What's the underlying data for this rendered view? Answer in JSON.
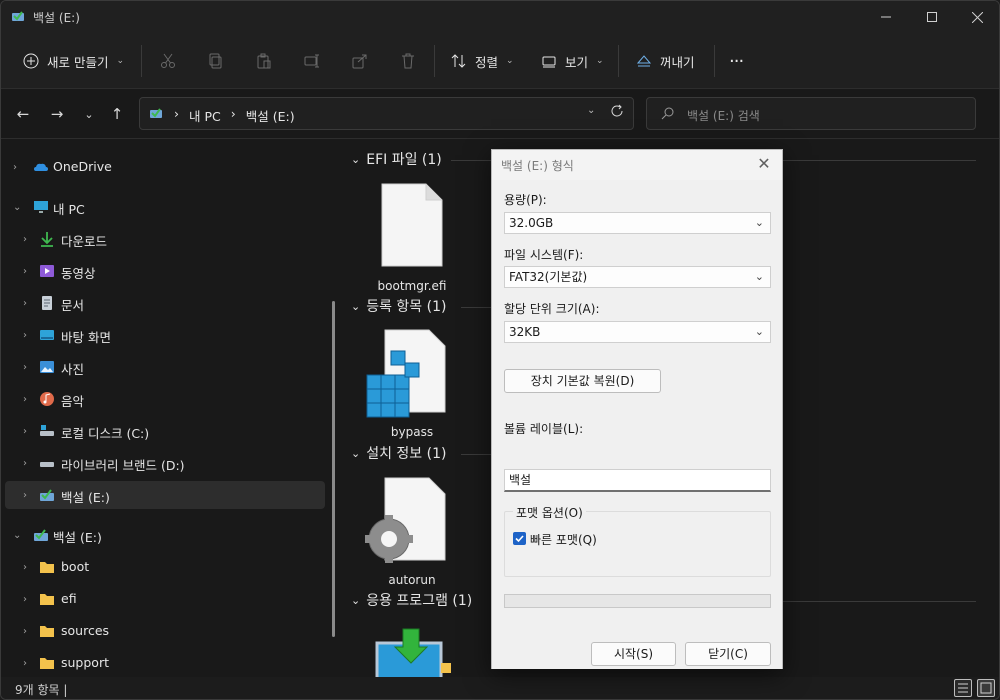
{
  "window": {
    "title": "백설 (E:)"
  },
  "toolbar": {
    "new_label": "새로 만들기",
    "sort_label": "정렬",
    "view_label": "보기",
    "eject_label": "꺼내기",
    "more_label": "···"
  },
  "address": {
    "crumbs": [
      "내 PC",
      "백설 (E:)"
    ]
  },
  "search": {
    "placeholder": "백설 (E:) 검색"
  },
  "sidebar": {
    "items": [
      {
        "label": "OneDrive",
        "icon": "onedrive-icon"
      },
      {
        "label": "내 PC",
        "icon": "pc-icon"
      },
      {
        "label": "다운로드",
        "icon": "download-icon"
      },
      {
        "label": "동영상",
        "icon": "video-icon"
      },
      {
        "label": "문서",
        "icon": "document-icon"
      },
      {
        "label": "바탕 화면",
        "icon": "desktop-icon"
      },
      {
        "label": "사진",
        "icon": "picture-icon"
      },
      {
        "label": "음악",
        "icon": "music-icon"
      },
      {
        "label": "로컬 디스크 (C:)",
        "icon": "drive-icon"
      },
      {
        "label": "라이브러리 브랜드 (D:)",
        "icon": "drive-icon"
      },
      {
        "label": "백설 (E:)",
        "icon": "usb-drive-icon"
      },
      {
        "label": "백설 (E:)",
        "icon": "usb-drive-icon"
      },
      {
        "label": "boot",
        "icon": "folder-icon"
      },
      {
        "label": "efi",
        "icon": "folder-icon"
      },
      {
        "label": "sources",
        "icon": "folder-icon"
      },
      {
        "label": "support",
        "icon": "folder-icon"
      }
    ]
  },
  "content": {
    "groups": [
      {
        "title": "EFI 파일 (1)",
        "file": "bootmgr.efi"
      },
      {
        "title": "등록 항목 (1)",
        "file": "bypass"
      },
      {
        "title": "설치 정보 (1)",
        "file": "autorun"
      },
      {
        "title": "응용 프로그램 (1)",
        "file": ""
      }
    ]
  },
  "status": {
    "count": "9개 항목  |"
  },
  "dialog": {
    "title": "백설 (E:) 형식",
    "capacity_label": "용량(P):",
    "capacity_value": "32.0GB",
    "fs_label": "파일 시스템(F):",
    "fs_value": "FAT32(기본값)",
    "alloc_label": "할당 단위 크기(A):",
    "alloc_value": "32KB",
    "restore_label": "장치 기본값 복원(D)",
    "volume_label_label": "볼륨 레이블(L):",
    "volume_label_value": "백설",
    "options_label": "포맷 옵션(O)",
    "quick_format_label": "빠른 포맷(Q)",
    "quick_format_checked": true,
    "progress": 0,
    "start_label": "시작(S)",
    "close_label": "닫기(C)"
  },
  "colors": {
    "accent": "#1d63c7",
    "folder": "#f3c24c",
    "dark_bg": "#191919"
  }
}
